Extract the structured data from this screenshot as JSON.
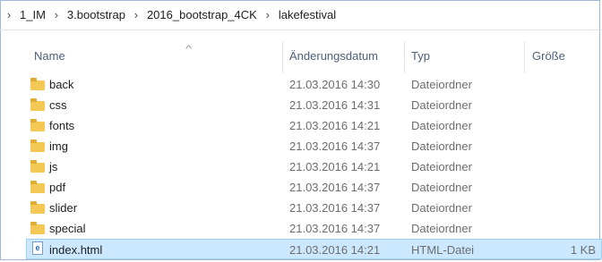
{
  "breadcrumb": {
    "items": [
      "1_IM",
      "3.bootstrap",
      "2016_bootstrap_4CK",
      "lakefestival"
    ]
  },
  "columns": {
    "name": "Name",
    "date": "Änderungsdatum",
    "type": "Typ",
    "size": "Größe"
  },
  "files": [
    {
      "name": "back",
      "date": "21.03.2016 14:30",
      "type": "Dateiordner",
      "size": "",
      "icon": "folder-icon"
    },
    {
      "name": "css",
      "date": "21.03.2016 14:31",
      "type": "Dateiordner",
      "size": "",
      "icon": "folder-icon"
    },
    {
      "name": "fonts",
      "date": "21.03.2016 14:21",
      "type": "Dateiordner",
      "size": "",
      "icon": "folder-icon"
    },
    {
      "name": "img",
      "date": "21.03.2016 14:37",
      "type": "Dateiordner",
      "size": "",
      "icon": "folder-icon"
    },
    {
      "name": "js",
      "date": "21.03.2016 14:21",
      "type": "Dateiordner",
      "size": "",
      "icon": "folder-icon"
    },
    {
      "name": "pdf",
      "date": "21.03.2016 14:37",
      "type": "Dateiordner",
      "size": "",
      "icon": "folder-icon"
    },
    {
      "name": "slider",
      "date": "21.03.2016 14:37",
      "type": "Dateiordner",
      "size": "",
      "icon": "folder-icon"
    },
    {
      "name": "special",
      "date": "21.03.2016 14:37",
      "type": "Dateiordner",
      "size": "",
      "icon": "folder-icon"
    },
    {
      "name": "index.html",
      "date": "21.03.2016 14:21",
      "type": "HTML-Datei",
      "size": "1 KB",
      "icon": "html-file-icon",
      "selected": true
    }
  ],
  "colors": {
    "selection": "#cce8ff",
    "selection_border": "#99d1ff",
    "header_text": "#4c607a",
    "folder": "#f4c855"
  }
}
